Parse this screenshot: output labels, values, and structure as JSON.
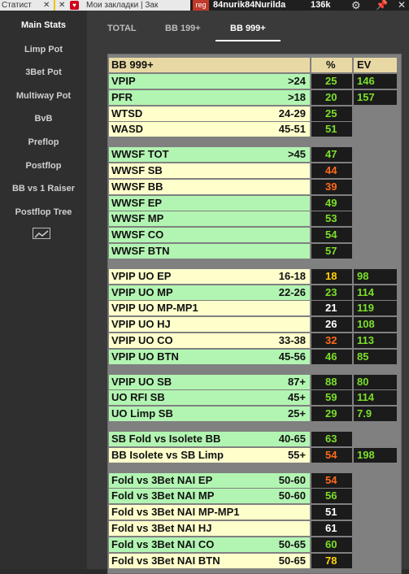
{
  "browser": {
    "tab1": "Статист",
    "tab2": "Мои закладки | Зак",
    "reg_badge": "reg",
    "username": "84nurik84Nurilda",
    "coins": "136k"
  },
  "sidebar": {
    "items": [
      {
        "label": "Main Stats",
        "active": true
      },
      {
        "label": "Limp Pot"
      },
      {
        "label": "3Bet Pot"
      },
      {
        "label": "Multiway Pot"
      },
      {
        "label": "BvB"
      },
      {
        "label": "Preflop"
      },
      {
        "label": "Postflop"
      },
      {
        "label": "BB vs 1 Raiser"
      },
      {
        "label": "Postflop Tree"
      }
    ]
  },
  "tabs": [
    {
      "label": "TOTAL"
    },
    {
      "label": "BB 199+"
    },
    {
      "label": "BB 999+",
      "active": true
    }
  ],
  "table": {
    "header": {
      "label": "BB 999+",
      "pct": "%",
      "ev": "EV"
    },
    "colors": {
      "green": "#7cdf2a",
      "orange": "#ff6a1a",
      "yellow": "#ffd200",
      "white": "#ffffff"
    },
    "groups": [
      [
        {
          "label": "VPIP",
          "range": ">24",
          "pct": "25",
          "pct_color": "green",
          "ev": "146",
          "bg": "g"
        },
        {
          "label": "PFR",
          "range": ">18",
          "pct": "20",
          "pct_color": "green",
          "ev": "157",
          "bg": "g"
        },
        {
          "label": "WTSD",
          "range": "24-29",
          "pct": "25",
          "pct_color": "green",
          "ev": "",
          "bg": "y"
        },
        {
          "label": "WASD",
          "range": "45-51",
          "pct": "51",
          "pct_color": "green",
          "ev": "",
          "bg": "y"
        }
      ],
      [
        {
          "label": "WWSF TOT",
          "range": ">45",
          "pct": "47",
          "pct_color": "green",
          "ev": "",
          "bg": "g"
        },
        {
          "label": "WWSF SB",
          "range": "",
          "pct": "44",
          "pct_color": "orange",
          "ev": "",
          "bg": "y"
        },
        {
          "label": "WWSF BB",
          "range": "",
          "pct": "39",
          "pct_color": "orange",
          "ev": "",
          "bg": "y"
        },
        {
          "label": "WWSF EP",
          "range": "",
          "pct": "49",
          "pct_color": "green",
          "ev": "",
          "bg": "g"
        },
        {
          "label": "WWSF MP",
          "range": "",
          "pct": "53",
          "pct_color": "green",
          "ev": "",
          "bg": "g"
        },
        {
          "label": "WWSF CO",
          "range": "",
          "pct": "54",
          "pct_color": "green",
          "ev": "",
          "bg": "g"
        },
        {
          "label": "WWSF BTN",
          "range": "",
          "pct": "57",
          "pct_color": "green",
          "ev": "",
          "bg": "g"
        }
      ],
      [
        {
          "label": "VPIP UO EP",
          "range": "16-18",
          "pct": "18",
          "pct_color": "yellow",
          "ev": "98",
          "bg": "y"
        },
        {
          "label": "VPIP UO MP",
          "range": "22-26",
          "pct": "23",
          "pct_color": "green",
          "ev": "114",
          "bg": "g"
        },
        {
          "label": "VPIP UO MP-MP1",
          "range": "",
          "pct": "21",
          "pct_color": "white",
          "ev": "119",
          "bg": "y"
        },
        {
          "label": "VPIP UO HJ",
          "range": "",
          "pct": "26",
          "pct_color": "white",
          "ev": "108",
          "bg": "y"
        },
        {
          "label": "VPIP UO CO",
          "range": "33-38",
          "pct": "32",
          "pct_color": "orange",
          "ev": "113",
          "bg": "y"
        },
        {
          "label": "VPIP UO BTN",
          "range": "45-56",
          "pct": "46",
          "pct_color": "green",
          "ev": "85",
          "bg": "g"
        }
      ],
      [
        {
          "label": "VPIP UO SB",
          "range": "87+",
          "pct": "88",
          "pct_color": "green",
          "ev": "80",
          "bg": "g"
        },
        {
          "label": "UO RFI SB",
          "range": "45+",
          "pct": "59",
          "pct_color": "green",
          "ev": "114",
          "bg": "g"
        },
        {
          "label": "UO Limp SB",
          "range": "25+",
          "pct": "29",
          "pct_color": "green",
          "ev": "7.9",
          "bg": "g"
        }
      ],
      [
        {
          "label": "SB Fold vs Isolete BB",
          "range": "40-65",
          "pct": "63",
          "pct_color": "green",
          "ev": "",
          "bg": "g"
        },
        {
          "label": "BB Isolete vs SB Limp",
          "range": "55+",
          "pct": "54",
          "pct_color": "orange",
          "ev": "198",
          "bg": "y"
        }
      ],
      [
        {
          "label": "Fold vs 3Bet NAI EP",
          "range": "50-60",
          "pct": "54",
          "pct_color": "orange",
          "ev": "",
          "bg": "g"
        },
        {
          "label": "Fold vs 3Bet NAI MP",
          "range": "50-60",
          "pct": "56",
          "pct_color": "green",
          "ev": "",
          "bg": "g"
        },
        {
          "label": "Fold vs 3Bet NAI MP-MP1",
          "range": "",
          "pct": "51",
          "pct_color": "white",
          "ev": "",
          "bg": "y"
        },
        {
          "label": "Fold vs 3Bet NAI HJ",
          "range": "",
          "pct": "61",
          "pct_color": "white",
          "ev": "",
          "bg": "y"
        },
        {
          "label": "Fold vs 3Bet NAI CO",
          "range": "50-65",
          "pct": "60",
          "pct_color": "green",
          "ev": "",
          "bg": "g"
        },
        {
          "label": "Fold vs 3Bet NAI BTN",
          "range": "50-65",
          "pct": "78",
          "pct_color": "yellow",
          "ev": "",
          "bg": "y"
        }
      ]
    ]
  }
}
